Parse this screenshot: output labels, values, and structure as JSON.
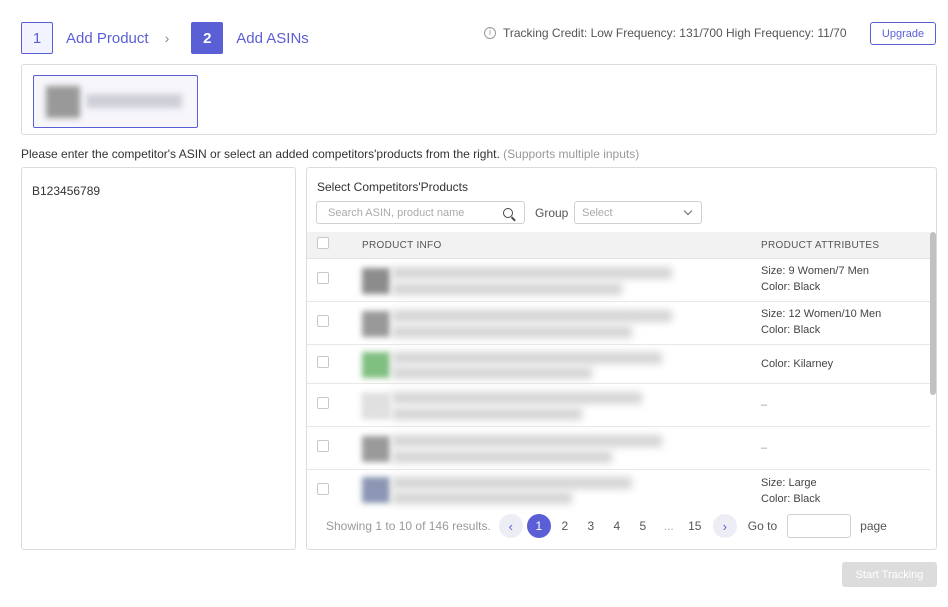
{
  "steps": [
    {
      "number": "1",
      "label": "Add Product"
    },
    {
      "number": "2",
      "label": "Add ASINs"
    }
  ],
  "credit": {
    "text": "Tracking Credit: Low Frequency: 131/700 High Frequency: 11/70",
    "info_icon": "i"
  },
  "upgrade_label": "Upgrade",
  "instruction": {
    "main": "Please enter the competitor's ASIN or select an added competitors'products from the right.",
    "hint": "(Supports multiple inputs)"
  },
  "asin_input_value": "B123456789",
  "competitors": {
    "title": "Select Competitors'Products",
    "search_placeholder": "Search ASIN, product name",
    "group_label": "Group",
    "group_placeholder": "Select",
    "columns": {
      "info": "PRODUCT INFO",
      "attributes": "PRODUCT ATTRIBUTES"
    },
    "rows": [
      {
        "attr1": "Size: 9 Women/7 Men",
        "attr2": "Color: Black"
      },
      {
        "attr1": "Size: 12 Women/10 Men",
        "attr2": "Color: Black"
      },
      {
        "attr1": "Color: Kilarney",
        "attr2": ""
      },
      {
        "attr1": "–",
        "attr2": ""
      },
      {
        "attr1": "–",
        "attr2": ""
      },
      {
        "attr1": "Size: Large",
        "attr2": "Color: Black"
      }
    ]
  },
  "pagination": {
    "result_text": "Showing 1 to 10 of 146 results.",
    "prev": "‹",
    "next": "›",
    "pages": [
      "1",
      "2",
      "3",
      "4",
      "5",
      "...",
      "15"
    ],
    "goto_label": "Go to",
    "page_label": "page"
  },
  "start_tracking_label": "Start Tracking",
  "colors": {
    "accent": "#5b5fd6",
    "disabled": "#dcdcdc"
  }
}
